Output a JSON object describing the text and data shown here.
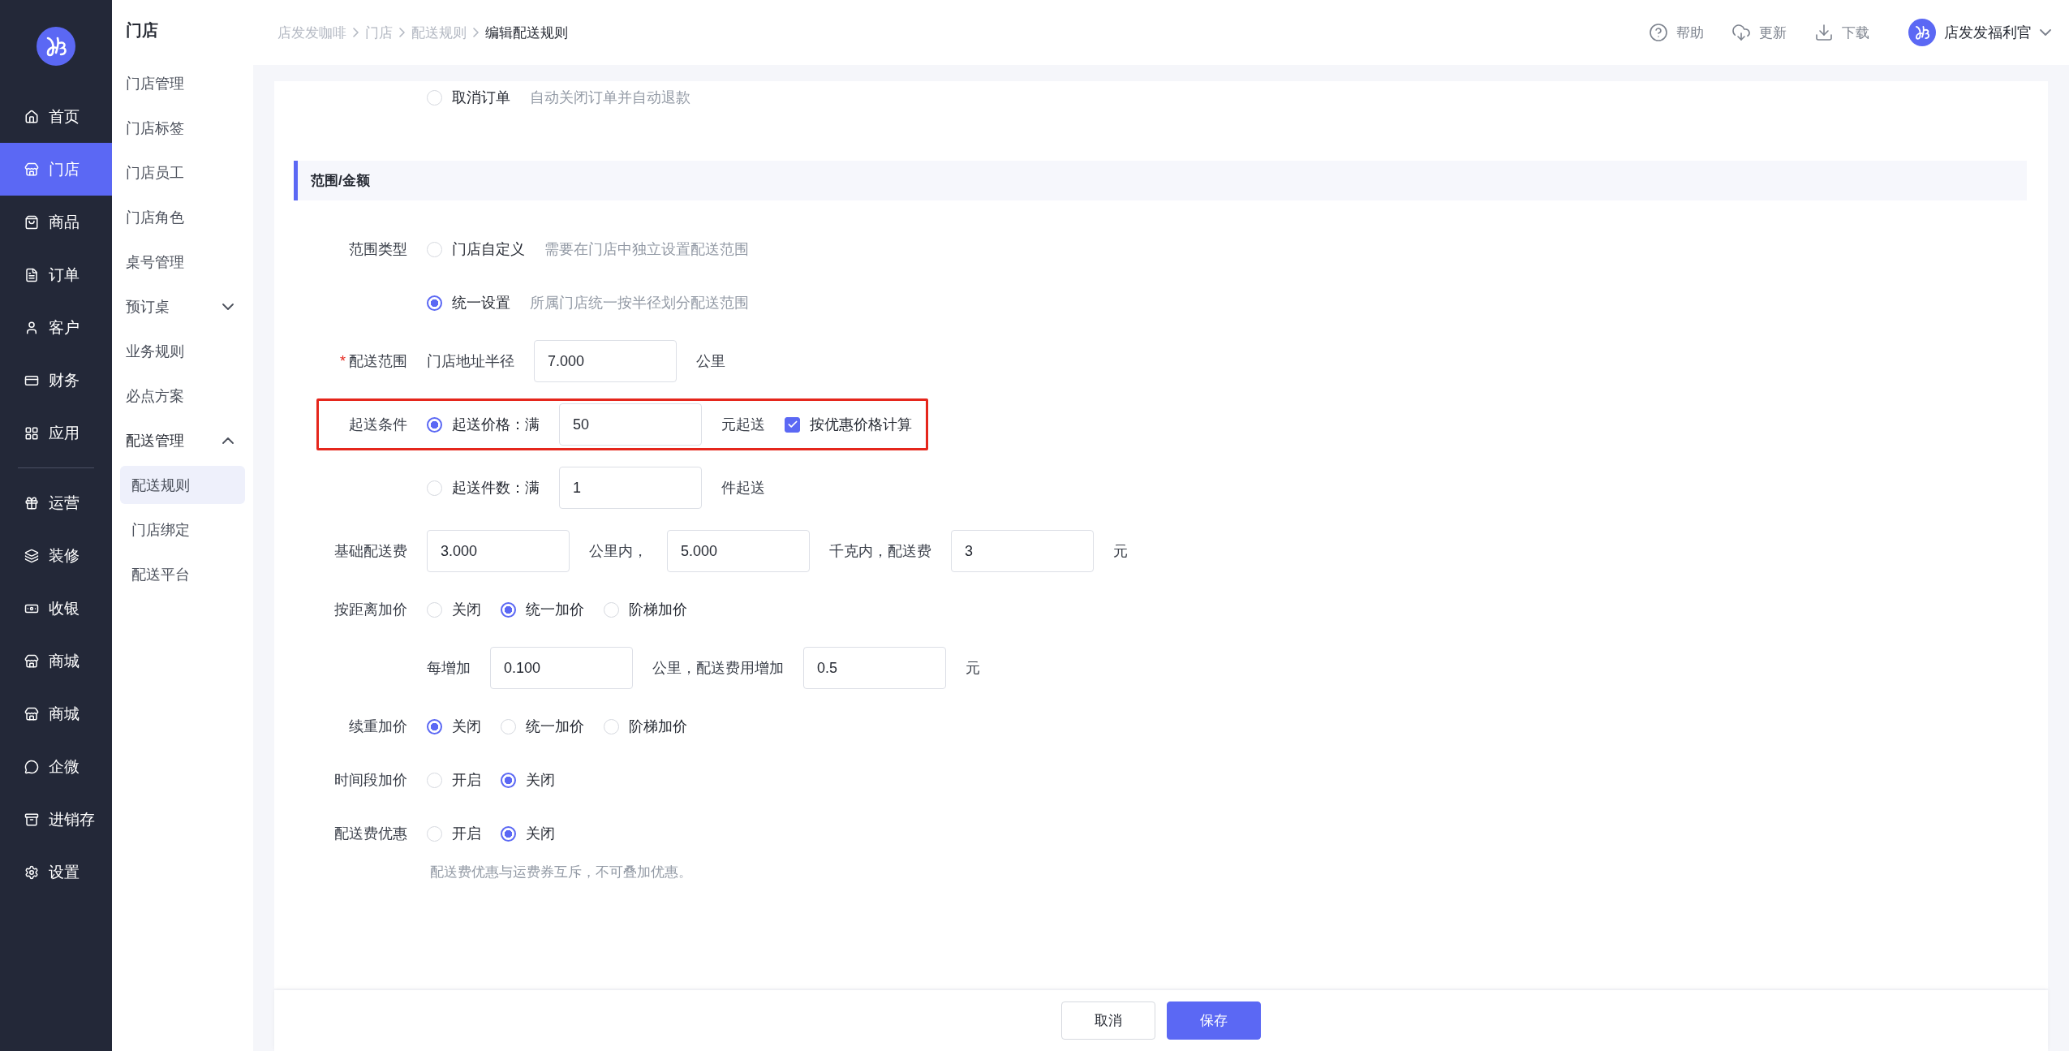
{
  "nav": {
    "groups": [
      [
        {
          "label": "首页",
          "selected": false
        },
        {
          "label": "门店",
          "selected": true
        },
        {
          "label": "商品",
          "selected": false
        },
        {
          "label": "订单",
          "selected": false
        },
        {
          "label": "客户",
          "selected": false
        },
        {
          "label": "财务",
          "selected": false
        },
        {
          "label": "应用",
          "selected": false
        }
      ],
      [
        {
          "label": "运营",
          "selected": false
        },
        {
          "label": "装修",
          "selected": false
        },
        {
          "label": "收银",
          "selected": false
        },
        {
          "label": "商城",
          "selected": false
        },
        {
          "label": "商城",
          "selected": false
        },
        {
          "label": "企微",
          "selected": false
        },
        {
          "label": "进销存",
          "selected": false
        },
        {
          "label": "设置",
          "selected": false
        }
      ]
    ]
  },
  "subnav": {
    "title": "门店",
    "items": [
      {
        "label": "门店管理",
        "selected": false
      },
      {
        "label": "门店标签",
        "selected": false
      },
      {
        "label": "门店员工",
        "selected": false
      },
      {
        "label": "门店角色",
        "selected": false
      },
      {
        "label": "桌号管理",
        "selected": false
      },
      {
        "label": "预订桌",
        "selected": false,
        "expanded": false
      },
      {
        "label": "业务规则",
        "selected": false
      },
      {
        "label": "必点方案",
        "selected": false
      },
      {
        "label": "配送管理",
        "selected": false,
        "expanded": true,
        "children": [
          {
            "label": "配送规则",
            "selected": true
          },
          {
            "label": "门店绑定",
            "selected": false
          },
          {
            "label": "配送平台",
            "selected": false
          }
        ]
      }
    ]
  },
  "breadcrumb": [
    "店发发咖啡",
    "门店",
    "配送规则",
    "编辑配送规则"
  ],
  "header_actions": [
    {
      "label": "帮助"
    },
    {
      "label": "更新"
    },
    {
      "label": "下载"
    }
  ],
  "user": {
    "name": "店发发福利官"
  },
  "form": {
    "blocks": [
      {
        "kind": "row",
        "items": [
          {
            "kind": "radio",
            "label": "取消订单",
            "selected": false
          },
          {
            "kind": "hint",
            "text": "自动关闭订单并自动退款"
          }
        ]
      },
      {
        "kind": "section",
        "title": "范围/金额"
      },
      {
        "kind": "row",
        "label": "范围类型",
        "items": [
          {
            "kind": "radio",
            "label": "门店自定义",
            "selected": false
          },
          {
            "kind": "hint",
            "text": "需要在门店中独立设置配送范围"
          }
        ]
      },
      {
        "kind": "row",
        "items": [
          {
            "kind": "radio",
            "label": "统一设置",
            "selected": true
          },
          {
            "kind": "hint",
            "text": "所属门店统一按半径划分配送范围"
          }
        ]
      },
      {
        "kind": "row",
        "label": "配送范围",
        "required_mark": "*",
        "items": [
          {
            "kind": "text",
            "text": "门店地址半径"
          },
          {
            "kind": "input",
            "value": "7.000"
          },
          {
            "kind": "text",
            "text": "公里"
          }
        ]
      },
      {
        "kind": "row",
        "label": "起送条件",
        "highlighted": true,
        "items": [
          {
            "kind": "radio",
            "label": "起送价格：满",
            "selected": true
          },
          {
            "kind": "input",
            "value": "50"
          },
          {
            "kind": "text",
            "text": "元起送"
          },
          {
            "kind": "checkbox",
            "label": "按优惠价格计算",
            "checked": true
          }
        ]
      },
      {
        "kind": "row",
        "items": [
          {
            "kind": "radio",
            "label": "起送件数：满",
            "selected": false
          },
          {
            "kind": "input",
            "value": "1"
          },
          {
            "kind": "text",
            "text": "件起送"
          }
        ]
      },
      {
        "kind": "row",
        "label": "基础配送费",
        "items": [
          {
            "kind": "input",
            "value": "3.000"
          },
          {
            "kind": "text",
            "text": "公里内，"
          },
          {
            "kind": "input",
            "value": "5.000"
          },
          {
            "kind": "text",
            "text": "千克内，配送费"
          },
          {
            "kind": "input",
            "value": "3"
          },
          {
            "kind": "text",
            "text": "元"
          }
        ]
      },
      {
        "kind": "row",
        "label": "按距离加价",
        "items": [
          {
            "kind": "radio",
            "label": "关闭",
            "selected": false
          },
          {
            "kind": "radio",
            "label": "统一加价",
            "selected": true
          },
          {
            "kind": "radio",
            "label": "阶梯加价",
            "selected": false
          }
        ]
      },
      {
        "kind": "row",
        "items": [
          {
            "kind": "text",
            "text": "每增加"
          },
          {
            "kind": "input",
            "value": "0.100"
          },
          {
            "kind": "text",
            "text": "公里，配送费用增加"
          },
          {
            "kind": "input",
            "value": "0.5"
          },
          {
            "kind": "text",
            "text": "元"
          }
        ]
      },
      {
        "kind": "row",
        "label": "续重加价",
        "items": [
          {
            "kind": "radio",
            "label": "关闭",
            "selected": true
          },
          {
            "kind": "radio",
            "label": "统一加价",
            "selected": false
          },
          {
            "kind": "radio",
            "label": "阶梯加价",
            "selected": false
          }
        ]
      },
      {
        "kind": "row",
        "label": "时间段加价",
        "items": [
          {
            "kind": "radio",
            "label": "开启",
            "selected": false
          },
          {
            "kind": "radio",
            "label": "关闭",
            "selected": true
          }
        ]
      },
      {
        "kind": "row",
        "label": "配送费优惠",
        "items": [
          {
            "kind": "radio",
            "label": "开启",
            "selected": false
          },
          {
            "kind": "radio",
            "label": "关闭",
            "selected": true
          }
        ]
      },
      {
        "kind": "note",
        "text": "配送费优惠与运费券互斥，不可叠加优惠。"
      }
    ]
  },
  "footer_buttons": [
    {
      "label": "取消",
      "kind": "secondary"
    },
    {
      "label": "保存",
      "kind": "primary"
    }
  ]
}
